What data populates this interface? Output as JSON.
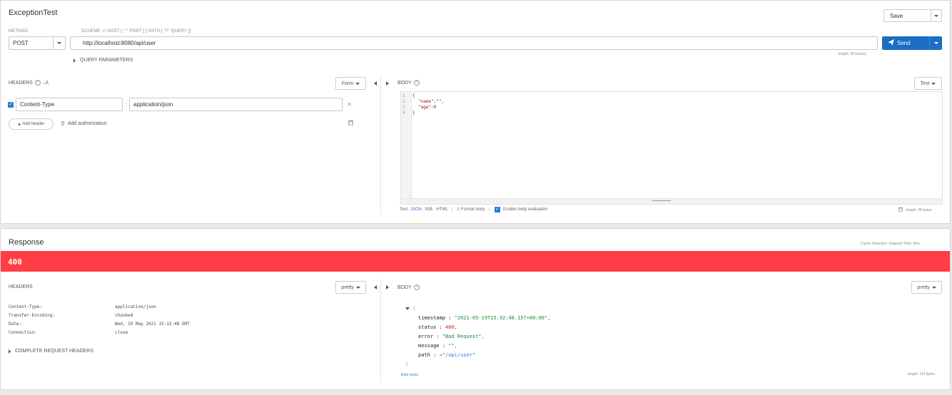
{
  "request": {
    "title": "ExceptionTest",
    "save_label": "Save",
    "method_label": "METHOD",
    "method_value": "POST",
    "url_label": "SCHEME :// HOST [ \":\" PORT ] [ PATH [ \"?\" QUERY ]]",
    "url_value": "http://localhost:8080/api/user",
    "send_label": "Send",
    "length_url": "length: 30 byte(s)",
    "query_params_label": "QUERY PARAMETERS",
    "headers_label": "HEADERS",
    "headers_mode": "Form",
    "header_name": "Content-Type",
    "header_value": "application/json",
    "add_header_label": "Add header",
    "add_auth_label": "Add authorization",
    "body_label": "BODY",
    "body_mode": "Text",
    "body_lines": [
      {
        "num": "1",
        "text": "{"
      },
      {
        "num": "2",
        "key": "\"name\"",
        "rest": ":\"\","
      },
      {
        "num": "3",
        "key": "\"age\"",
        "rest": ":0"
      },
      {
        "num": "4",
        "text": "}"
      }
    ],
    "footer": {
      "text": "Text",
      "json": "JSON",
      "xml": "XML",
      "html": "HTML",
      "sep": "|",
      "format_body": "Format body",
      "enable_eval": "Enable body evaluation",
      "length": "length: 28 bytes"
    }
  },
  "response": {
    "title": "Response",
    "cache_info": "Cache Detected - Elapsed Time: 9ms",
    "status_code": "400",
    "status_color": "#ff3d45",
    "headers_label": "HEADERS",
    "headers_mode": "pretty",
    "headers": [
      {
        "name": "Content-Type:",
        "value": "application/json"
      },
      {
        "name": "Transfer-Encoding:",
        "value": "chunked"
      },
      {
        "name": "Date:",
        "value": "Wed, 19 May 2021 15:32:48 GMT"
      },
      {
        "name": "Connection:",
        "value": "close"
      }
    ],
    "complete_headers_label": "COMPLETE REQUEST HEADERS",
    "body_label": "BODY",
    "body_mode": "pretty",
    "json_open": "{",
    "json_close": "}",
    "fields": {
      "timestamp_key": "timestamp :",
      "timestamp_val": "\"2021-05-19T15:32:48.157+00:00\",",
      "status_key": "status :",
      "status_val": "400,",
      "error_key": "error :",
      "error_val": "\"Bad Request\",",
      "message_key": "message :",
      "message_val": "\"\",",
      "path_key": "path :",
      "path_val": "\"/api/user\""
    },
    "lines_nums": "lines nums",
    "length": "length: 112 bytes"
  },
  "colors": {
    "accent": "#1a6ec4",
    "link": "#2a7ad6",
    "string_green": "#1a8a3a",
    "number_red": "#c0302a",
    "key_red": "#a01a1a"
  }
}
